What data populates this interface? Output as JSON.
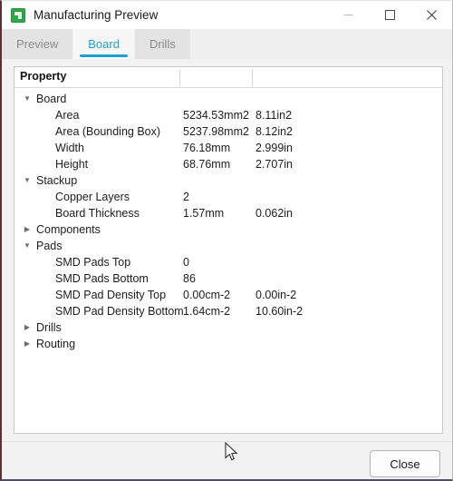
{
  "window": {
    "title": "Manufacturing Preview",
    "icon": "app-board-icon",
    "controls": {
      "minimize": "minimize-icon",
      "maximize": "maximize-icon",
      "close": "close-icon"
    }
  },
  "tabs": [
    {
      "label": "Preview",
      "active": false
    },
    {
      "label": "Board",
      "active": true
    },
    {
      "label": "Drills",
      "active": false
    }
  ],
  "accent_color": "#1a9fd9",
  "tree": {
    "header": "Property",
    "rows": [
      {
        "type": "group",
        "state": "expanded",
        "twisty": "▼",
        "label": "Board",
        "v1": "",
        "v2": ""
      },
      {
        "type": "leaf",
        "state": "",
        "twisty": "",
        "label": "Area",
        "v1": "5234.53mm2",
        "v2": "8.11in2"
      },
      {
        "type": "leaf",
        "state": "",
        "twisty": "",
        "label": "Area (Bounding Box)",
        "v1": "5237.98mm2",
        "v2": "8.12in2"
      },
      {
        "type": "leaf",
        "state": "",
        "twisty": "",
        "label": "Width",
        "v1": "76.18mm",
        "v2": "2.999in"
      },
      {
        "type": "leaf",
        "state": "",
        "twisty": "",
        "label": "Height",
        "v1": "68.76mm",
        "v2": "2.707in"
      },
      {
        "type": "group",
        "state": "expanded",
        "twisty": "▼",
        "label": "Stackup",
        "v1": "",
        "v2": ""
      },
      {
        "type": "leaf",
        "state": "",
        "twisty": "",
        "label": "Copper Layers",
        "v1": "2",
        "v2": ""
      },
      {
        "type": "leaf",
        "state": "",
        "twisty": "",
        "label": "Board Thickness",
        "v1": "1.57mm",
        "v2": "0.062in"
      },
      {
        "type": "group",
        "state": "collapsed",
        "twisty": "▶",
        "label": "Components",
        "v1": "",
        "v2": ""
      },
      {
        "type": "group",
        "state": "expanded",
        "twisty": "▼",
        "label": "Pads",
        "v1": "",
        "v2": ""
      },
      {
        "type": "leaf",
        "state": "",
        "twisty": "",
        "label": "SMD Pads Top",
        "v1": "0",
        "v2": ""
      },
      {
        "type": "leaf",
        "state": "",
        "twisty": "",
        "label": "SMD Pads Bottom",
        "v1": "86",
        "v2": ""
      },
      {
        "type": "leaf",
        "state": "",
        "twisty": "",
        "label": "SMD Pad Density Top",
        "v1": "0.00cm-2",
        "v2": "0.00in-2"
      },
      {
        "type": "leaf",
        "state": "",
        "twisty": "",
        "label": "SMD Pad Density Bottom",
        "v1": "1.64cm-2",
        "v2": "10.60in-2"
      },
      {
        "type": "group",
        "state": "collapsed",
        "twisty": "▶",
        "label": "Drills",
        "v1": "",
        "v2": ""
      },
      {
        "type": "group",
        "state": "collapsed",
        "twisty": "▶",
        "label": "Routing",
        "v1": "",
        "v2": ""
      }
    ]
  },
  "footer": {
    "close_label": "Close"
  }
}
